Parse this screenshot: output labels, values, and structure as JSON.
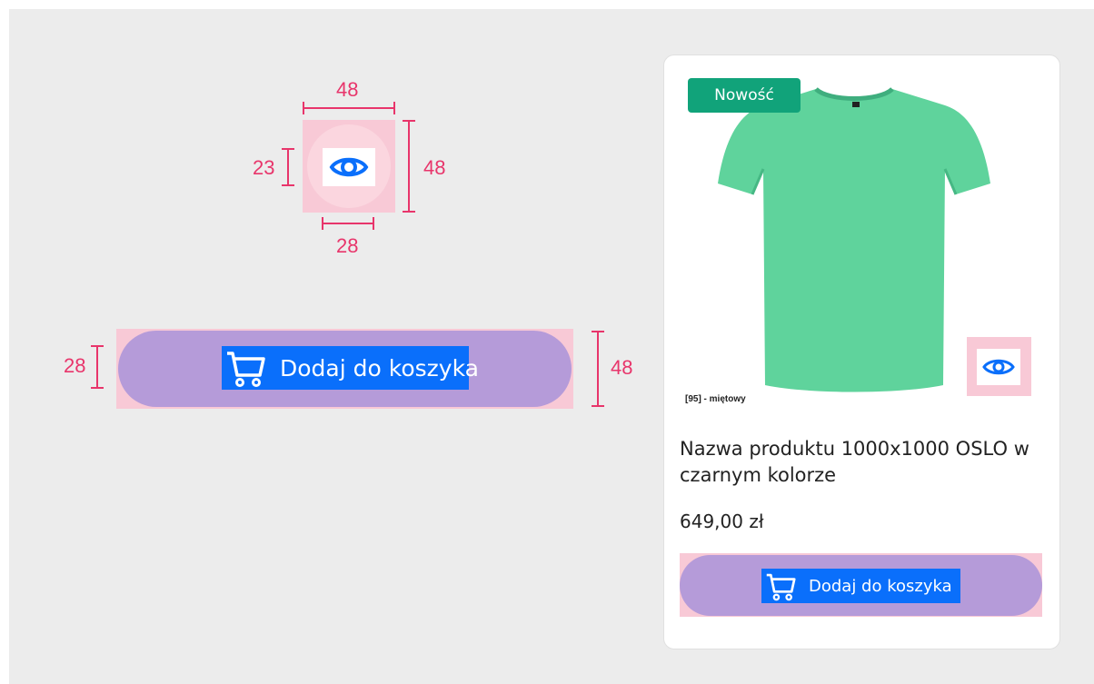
{
  "spec_eye": {
    "width_label": "48",
    "height_label": "48",
    "icon_height_label": "23",
    "icon_width_label": "28"
  },
  "spec_cart": {
    "label": "Dodaj do koszyka",
    "icon_height_label": "28",
    "height_label": "48"
  },
  "card": {
    "badge": "Nowość",
    "color_label": "[95] - miętowy",
    "product_name": "Nazwa produktu 1000x1000 OSLO w czarnym kolorze",
    "price": "649,00 zł",
    "cart_label": "Dodaj do koszyka"
  },
  "colors": {
    "accent_pink": "#e8356b",
    "button_purple": "#b59bd9",
    "label_blue": "#0a6ffb",
    "badge_green": "#11a37a",
    "shirt_mint": "#5fd39c"
  },
  "icons": [
    "eye-icon",
    "cart-icon"
  ]
}
